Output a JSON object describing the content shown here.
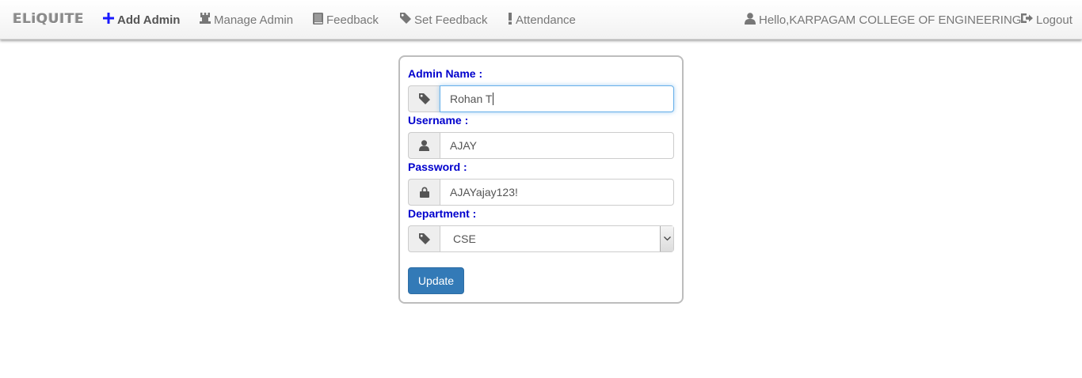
{
  "navbar": {
    "brand": "ELiQUITE",
    "items": [
      {
        "label": "Add Admin",
        "icon": "plus-icon"
      },
      {
        "label": "Manage Admin",
        "icon": "tower-icon"
      },
      {
        "label": "Feedback",
        "icon": "book-icon"
      },
      {
        "label": "Set Feedback",
        "icon": "tag-icon"
      },
      {
        "label": "Attendance",
        "icon": "exclamation-icon"
      }
    ],
    "user_greeting": "Hello,KARPAGAM COLLEGE OF ENGINEERING",
    "logout_label": "Logout"
  },
  "form": {
    "admin_name_label": "Admin Name :",
    "admin_name_value": "Rohan T",
    "username_label": "Username :",
    "username_value": "AJAY",
    "password_label": "Password :",
    "password_value": "AJAYajay123!",
    "department_label": "Department :",
    "department_selected": "CSE",
    "update_label": "Update"
  },
  "colors": {
    "label_blue": "#0000cd",
    "primary_button": "#337ab7",
    "plus_icon": "#1a1aff"
  }
}
